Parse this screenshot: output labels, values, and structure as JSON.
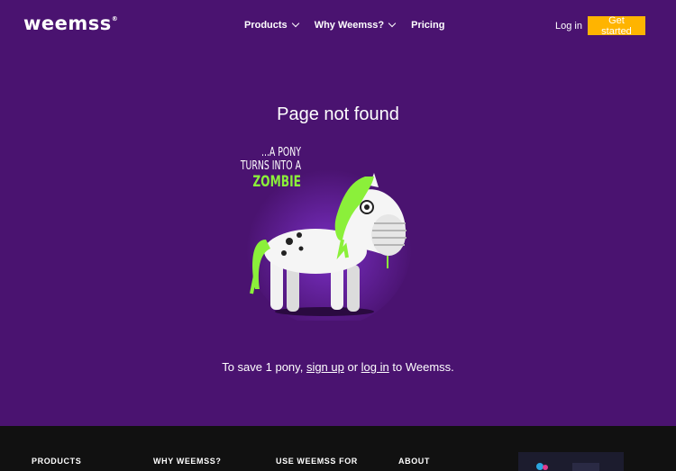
{
  "header": {
    "logo_text": "weemss",
    "logo_mark": "®",
    "nav": [
      {
        "label": "Products",
        "has_dropdown": true
      },
      {
        "label": "Why Weemss?",
        "has_dropdown": true
      },
      {
        "label": "Pricing",
        "has_dropdown": false
      }
    ],
    "login_label": "Log in",
    "cta_label": "Get started"
  },
  "main": {
    "title": "Page not found",
    "illustration": {
      "caption_lines": [
        "...A PONY",
        "TURNS INTO A"
      ],
      "caption_highlight": "ZOMBIE"
    },
    "message": {
      "prefix": "To save 1 pony,",
      "signup_link": "sign up",
      "middle": "or",
      "login_link": "log in",
      "suffix": "to Weemss."
    }
  },
  "footer": {
    "columns": [
      "PRODUCTS",
      "WHY WEEMSS?",
      "USE WEEMSS FOR",
      "ABOUT"
    ]
  },
  "colors": {
    "background": "#4a1370",
    "cta": "#ffb400",
    "footer": "#111111",
    "zombie_green": "#8bf03a"
  }
}
